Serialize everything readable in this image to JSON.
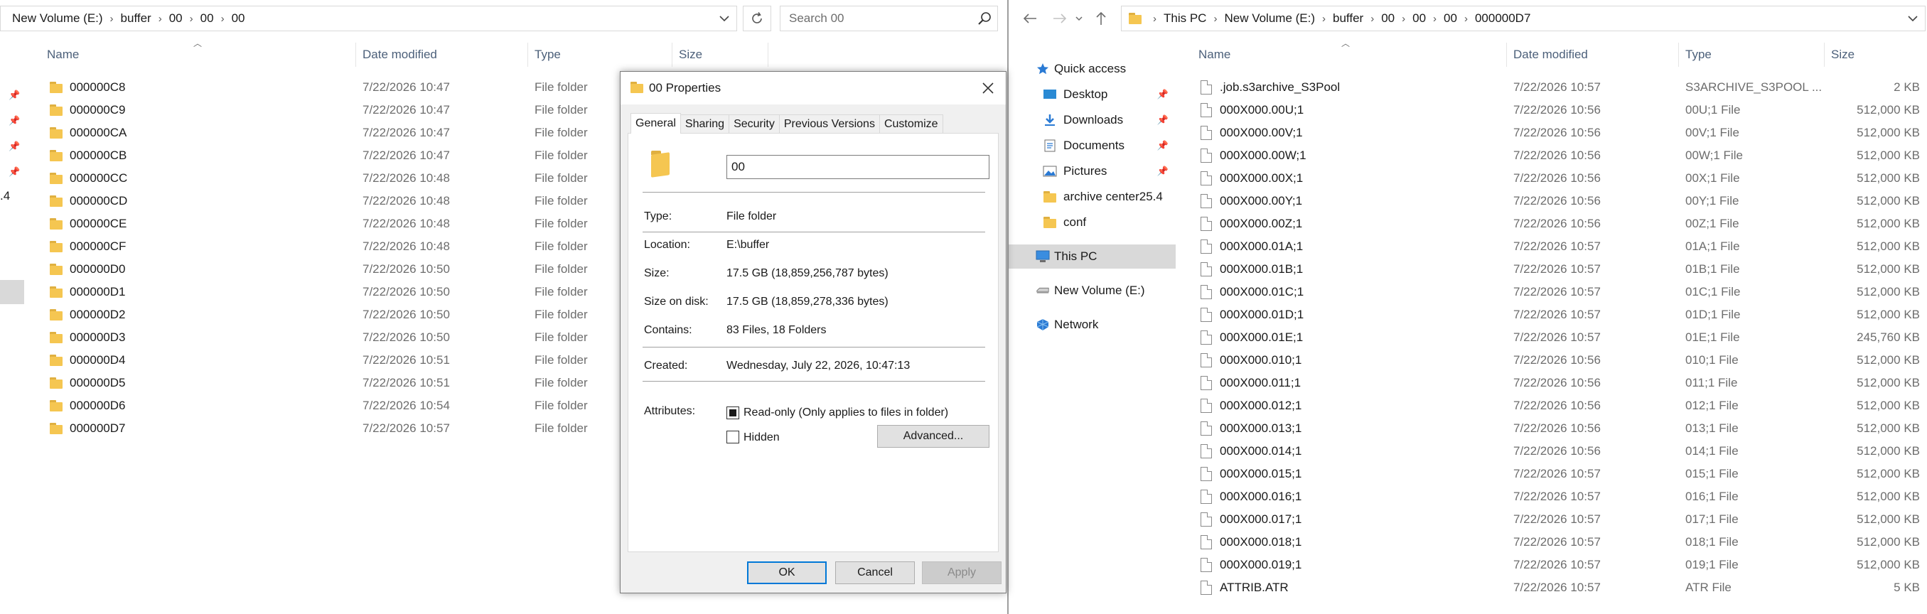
{
  "left": {
    "breadcrumb": [
      "New Volume (E:)",
      "buffer",
      "00",
      "00",
      "00"
    ],
    "search_placeholder": "Search 00",
    "columns": {
      "name": "Name",
      "date": "Date modified",
      "type": "Type",
      "size": "Size"
    },
    "nav_fragment": ".4",
    "rows": [
      {
        "name": "000000C8",
        "date": "7/22/2026 10:47",
        "type": "File folder"
      },
      {
        "name": "000000C9",
        "date": "7/22/2026 10:47",
        "type": "File folder"
      },
      {
        "name": "000000CA",
        "date": "7/22/2026 10:47",
        "type": "File folder"
      },
      {
        "name": "000000CB",
        "date": "7/22/2026 10:47",
        "type": "File folder"
      },
      {
        "name": "000000CC",
        "date": "7/22/2026 10:48",
        "type": "File folder"
      },
      {
        "name": "000000CD",
        "date": "7/22/2026 10:48",
        "type": "File folder"
      },
      {
        "name": "000000CE",
        "date": "7/22/2026 10:48",
        "type": "File folder"
      },
      {
        "name": "000000CF",
        "date": "7/22/2026 10:48",
        "type": "File folder"
      },
      {
        "name": "000000D0",
        "date": "7/22/2026 10:50",
        "type": "File folder"
      },
      {
        "name": "000000D1",
        "date": "7/22/2026 10:50",
        "type": "File folder"
      },
      {
        "name": "000000D2",
        "date": "7/22/2026 10:50",
        "type": "File folder"
      },
      {
        "name": "000000D3",
        "date": "7/22/2026 10:50",
        "type": "File folder"
      },
      {
        "name": "000000D4",
        "date": "7/22/2026 10:51",
        "type": "File folder"
      },
      {
        "name": "000000D5",
        "date": "7/22/2026 10:51",
        "type": "File folder"
      },
      {
        "name": "000000D6",
        "date": "7/22/2026 10:54",
        "type": "File folder"
      },
      {
        "name": "000000D7",
        "date": "7/22/2026 10:57",
        "type": "File folder"
      }
    ]
  },
  "dialog": {
    "title": "00 Properties",
    "tabs": [
      "General",
      "Sharing",
      "Security",
      "Previous Versions",
      "Customize"
    ],
    "folder_name": "00",
    "type_label": "Type:",
    "type_value": "File folder",
    "location_label": "Location:",
    "location_value": "E:\\buffer",
    "size_label": "Size:",
    "size_value": "17.5 GB (18,859,256,787 bytes)",
    "size_on_disk_label": "Size on disk:",
    "size_on_disk_value": "17.5 GB (18,859,278,336 bytes)",
    "contains_label": "Contains:",
    "contains_value": "83 Files, 18 Folders",
    "created_label": "Created:",
    "created_value": "Wednesday, July 22, 2026, 10:47:13",
    "attributes_label": "Attributes:",
    "readonly_label": "Read-only (Only applies to files in folder)",
    "hidden_label": "Hidden",
    "advanced_label": "Advanced...",
    "ok_label": "OK",
    "cancel_label": "Cancel",
    "apply_label": "Apply"
  },
  "right": {
    "breadcrumb": [
      "This PC",
      "New Volume (E:)",
      "buffer",
      "00",
      "00",
      "00",
      "000000D7"
    ],
    "columns": {
      "name": "Name",
      "date": "Date modified",
      "type": "Type",
      "size": "Size"
    },
    "nav": {
      "quick_access": "Quick access",
      "desktop": "Desktop",
      "downloads": "Downloads",
      "documents": "Documents",
      "pictures": "Pictures",
      "archive": "archive center25.4",
      "conf": "conf",
      "this_pc": "This PC",
      "new_volume": "New Volume (E:)",
      "network": "Network"
    },
    "rows": [
      {
        "name": ".job.s3archive_S3Pool",
        "date": "7/22/2026 10:57",
        "type": "S3ARCHIVE_S3POOL ...",
        "size": "2 KB"
      },
      {
        "name": "000X000.00U;1",
        "date": "7/22/2026 10:56",
        "type": "00U;1 File",
        "size": "512,000 KB"
      },
      {
        "name": "000X000.00V;1",
        "date": "7/22/2026 10:56",
        "type": "00V;1 File",
        "size": "512,000 KB"
      },
      {
        "name": "000X000.00W;1",
        "date": "7/22/2026 10:56",
        "type": "00W;1 File",
        "size": "512,000 KB"
      },
      {
        "name": "000X000.00X;1",
        "date": "7/22/2026 10:56",
        "type": "00X;1 File",
        "size": "512,000 KB"
      },
      {
        "name": "000X000.00Y;1",
        "date": "7/22/2026 10:56",
        "type": "00Y;1 File",
        "size": "512,000 KB"
      },
      {
        "name": "000X000.00Z;1",
        "date": "7/22/2026 10:56",
        "type": "00Z;1 File",
        "size": "512,000 KB"
      },
      {
        "name": "000X000.01A;1",
        "date": "7/22/2026 10:57",
        "type": "01A;1 File",
        "size": "512,000 KB"
      },
      {
        "name": "000X000.01B;1",
        "date": "7/22/2026 10:57",
        "type": "01B;1 File",
        "size": "512,000 KB"
      },
      {
        "name": "000X000.01C;1",
        "date": "7/22/2026 10:57",
        "type": "01C;1 File",
        "size": "512,000 KB"
      },
      {
        "name": "000X000.01D;1",
        "date": "7/22/2026 10:57",
        "type": "01D;1 File",
        "size": "512,000 KB"
      },
      {
        "name": "000X000.01E;1",
        "date": "7/22/2026 10:57",
        "type": "01E;1 File",
        "size": "245,760 KB"
      },
      {
        "name": "000X000.010;1",
        "date": "7/22/2026 10:56",
        "type": "010;1 File",
        "size": "512,000 KB"
      },
      {
        "name": "000X000.011;1",
        "date": "7/22/2026 10:56",
        "type": "011;1 File",
        "size": "512,000 KB"
      },
      {
        "name": "000X000.012;1",
        "date": "7/22/2026 10:56",
        "type": "012;1 File",
        "size": "512,000 KB"
      },
      {
        "name": "000X000.013;1",
        "date": "7/22/2026 10:56",
        "type": "013;1 File",
        "size": "512,000 KB"
      },
      {
        "name": "000X000.014;1",
        "date": "7/22/2026 10:56",
        "type": "014;1 File",
        "size": "512,000 KB"
      },
      {
        "name": "000X000.015;1",
        "date": "7/22/2026 10:57",
        "type": "015;1 File",
        "size": "512,000 KB"
      },
      {
        "name": "000X000.016;1",
        "date": "7/22/2026 10:57",
        "type": "016;1 File",
        "size": "512,000 KB"
      },
      {
        "name": "000X000.017;1",
        "date": "7/22/2026 10:57",
        "type": "017;1 File",
        "size": "512,000 KB"
      },
      {
        "name": "000X000.018;1",
        "date": "7/22/2026 10:57",
        "type": "018;1 File",
        "size": "512,000 KB"
      },
      {
        "name": "000X000.019;1",
        "date": "7/22/2026 10:57",
        "type": "019;1 File",
        "size": "512,000 KB"
      },
      {
        "name": "ATTRIB.ATR",
        "date": "7/22/2026 10:57",
        "type": "ATR File",
        "size": "5 KB"
      }
    ]
  }
}
